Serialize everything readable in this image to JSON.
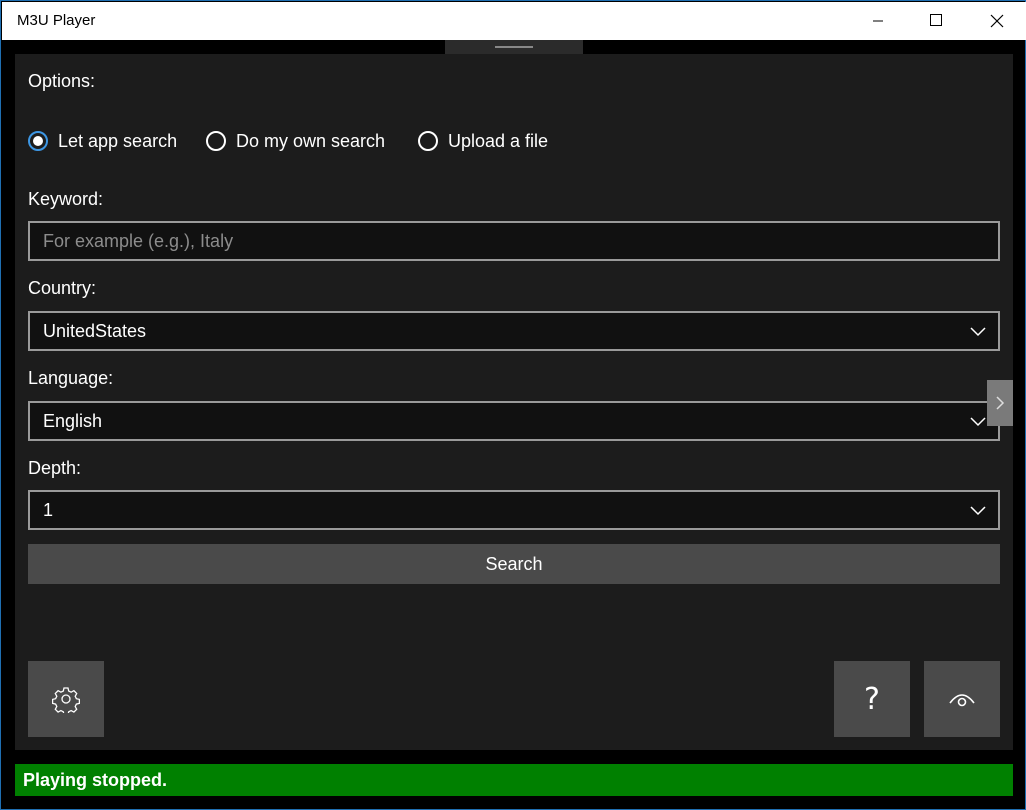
{
  "window": {
    "title": "M3U Player"
  },
  "options": {
    "label": "Options:",
    "radios": [
      {
        "label": "Let app search",
        "checked": true
      },
      {
        "label": "Do my own search",
        "checked": false
      },
      {
        "label": "Upload a file",
        "checked": false
      }
    ]
  },
  "keyword": {
    "label": "Keyword:",
    "value": "",
    "placeholder": "For example (e.g.), Italy"
  },
  "country": {
    "label": "Country:",
    "selected": "UnitedStates"
  },
  "language": {
    "label": "Language:",
    "selected": "English"
  },
  "depth": {
    "label": "Depth:",
    "selected": "1"
  },
  "search_button": {
    "label": "Search"
  },
  "help_button": {
    "glyph": "?"
  },
  "icons": {
    "settings": "gear-icon",
    "help": "question-icon",
    "view": "eye-icon",
    "expand": "chevron-right-icon"
  },
  "status": {
    "text": "Playing stopped.",
    "color": "#008000"
  },
  "colors": {
    "accent": "#3d97e4",
    "panel": "#1c1c1c"
  }
}
